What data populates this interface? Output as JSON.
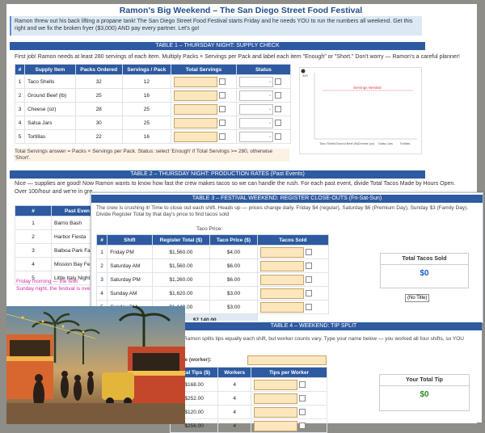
{
  "page": {
    "title": "Ramon's Big Weekend – The San Diego Street Food Festival",
    "intro": "Ramon threw out his back lifting a propane tank! The San Diego Street Food Festival starts Friday and he needs YOU to run the numbers all weekend. Get this right and we fix the broken fryer ($3,000) AND pay every partner. Let's go!"
  },
  "table1": {
    "title": "TABLE 1 – THURSDAY NIGHT: SUPPLY CHECK",
    "instructions": "First job! Ramon needs at least 280 servings of each item. Multiply Packs × Servings per Pack and label each item \"Enough\" or \"Short.\" Don't worry — Ramon's a careful planner!",
    "headers": [
      "#",
      "Supply Item",
      "Packs Ordered",
      "Servings / Pack",
      "Total Servings",
      "Status"
    ],
    "rows": [
      {
        "n": "1",
        "item": "Taco Shells",
        "packs": "32",
        "per": "12"
      },
      {
        "n": "2",
        "item": "Ground Beef (lb)",
        "packs": "25",
        "per": "16"
      },
      {
        "n": "3",
        "item": "Cheese (oz)",
        "packs": "28",
        "per": "25"
      },
      {
        "n": "4",
        "item": "Salsa Jars",
        "packs": "30",
        "per": "25"
      },
      {
        "n": "5",
        "item": "Tortillas",
        "packs": "22",
        "per": "16"
      }
    ],
    "footer": "Total Servings answer = Packs × Servings per Pack. Status: select 'Enough' if Total Servings >= 280, otherwise 'Short'."
  },
  "chart": {
    "ymax": "300",
    "threshold_label": "Servings Needed",
    "categories": [
      "Taco Shells",
      "Ground Beef (lb)",
      "Cheese (oz)",
      "Salsa Jars",
      "Tortillas"
    ]
  },
  "table2": {
    "title": "TABLE 2 – THURSDAY NIGHT: PRODUCTION RATES (Past Events)",
    "instructions1": "Nice — supplies are good! Now Ramon wants to know how fast the crew makes tacos so we can handle the rush. For each past event, divide Total Tacos Made by Hours Open.",
    "instructions2": "Over 100/hour and we're in gre",
    "headers": [
      "#",
      "Past Even"
    ],
    "rows": [
      {
        "n": "1",
        "name": "Barrio Bash"
      },
      {
        "n": "2",
        "name": "Harbor Fiesta"
      },
      {
        "n": "3",
        "name": "Balboa Park Fa"
      },
      {
        "n": "4",
        "name": "Mission Bay Fe"
      },
      {
        "n": "5",
        "name": "Little Italy Night"
      }
    ],
    "warning1": "Friday morning — the festi",
    "warning2": "Sunday night, the festival is ove"
  },
  "table3": {
    "title": "TABLE 3 – FESTIVAL WEEKEND: REGISTER CLOSE-OUTS (Fri-Sat-Sun)",
    "instructions": "The crew is crushing it! Time to close out each shift. Heads up — prices change daily. Friday $4 (regular), Saturday $6 (Premium Day), Sunday $3 (Family Day). Divide Register Total by that day's price to find tacos sold",
    "price_label": "Taco Price:",
    "headers": [
      "#",
      "Shift",
      "Register Total ($)",
      "Taco Price ($)",
      "Tacos Sold"
    ],
    "rows": [
      {
        "n": "1",
        "shift": "Friday PM",
        "total": "$1,560.00",
        "price": "$4.00"
      },
      {
        "n": "2",
        "shift": "Saturday AM",
        "total": "$1,560.00",
        "price": "$6.00"
      },
      {
        "n": "3",
        "shift": "Saturday PM",
        "total": "$1,260.00",
        "price": "$6.00"
      },
      {
        "n": "4",
        "shift": "Sunday AM",
        "total": "$1,620.00",
        "price": "$3.00"
      },
      {
        "n": "5",
        "shift": "Sunday PM",
        "total": "$1,140.00",
        "price": "$3.00"
      }
    ],
    "sum": "$7,140.00",
    "total_label": "Total Tacos Sold",
    "total_value": "$0",
    "tooltip": "(No Title)"
  },
  "table4": {
    "title": "TABLE 4 – WEEKEND: TIP SPLIT",
    "instructions": "ing in! Ramon splits tips equally each shift, but worker counts vary. Type your name below — you worked all four shifts, so YOU",
    "name_label": "r Name (worker):",
    "headers": [
      "Total Tips ($)",
      "Workers",
      "Tips per Worker"
    ],
    "rows": [
      {
        "tips": "$168.00",
        "workers": "4"
      },
      {
        "tips": "$252.00",
        "workers": "4"
      },
      {
        "tips": "$120.00",
        "workers": "4"
      },
      {
        "tips": "$256.00",
        "workers": "4"
      }
    ],
    "tip_label": "Your Total Tip",
    "tip_value": "$0"
  },
  "colors": {
    "header_blue": "#2d5aa0",
    "input_fill": "#fbe6bd",
    "total_blue": "#1a5fd0",
    "tip_green": "#2e8b2e"
  }
}
